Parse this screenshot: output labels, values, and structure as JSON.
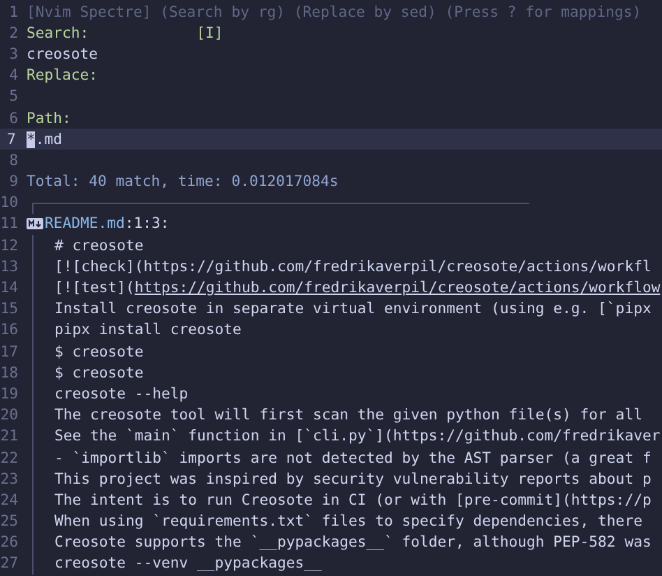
{
  "lines": [
    {
      "number": "1",
      "kind": "header",
      "current": false,
      "text": "[Nvim Spectre] (Search by rg)  (Replace by sed) (Press ? for mappings)"
    },
    {
      "number": "2",
      "kind": "label",
      "current": false,
      "text": "Search:",
      "flag": "[I]"
    },
    {
      "number": "3",
      "kind": "value",
      "current": false,
      "text": "creosote"
    },
    {
      "number": "4",
      "kind": "label",
      "current": false,
      "text": "Replace:"
    },
    {
      "number": "5",
      "kind": "blank",
      "current": false
    },
    {
      "number": "6",
      "kind": "label",
      "current": false,
      "text": "Path:"
    },
    {
      "number": "7",
      "kind": "input",
      "current": true,
      "cursor": "*",
      "text": ".md"
    },
    {
      "number": "8",
      "kind": "blank",
      "current": false
    },
    {
      "number": "9",
      "kind": "total",
      "current": false,
      "text": "Total: 40 match, time: 0.012017084s"
    },
    {
      "number": "10",
      "kind": "separator",
      "current": false
    },
    {
      "number": "11",
      "kind": "file",
      "current": false,
      "file": "README.md",
      "location": ":1:3:"
    },
    {
      "number": "12",
      "kind": "match",
      "current": false,
      "text": "# creosote"
    },
    {
      "number": "13",
      "kind": "match",
      "current": false,
      "text": "[![check](https://github.com/fredrikaverpil/creosote/actions/workfl"
    },
    {
      "number": "14",
      "kind": "match",
      "current": false,
      "text": "[![test](",
      "link": "https://github.com/fredrikaverpil/creosote/actions/workflow"
    },
    {
      "number": "15",
      "kind": "match",
      "current": false,
      "text": "Install creosote in separate virtual environment (using e.g. [`pipx"
    },
    {
      "number": "16",
      "kind": "match",
      "current": false,
      "text": "pipx install creosote"
    },
    {
      "number": "17",
      "kind": "match",
      "current": false,
      "text": "$ creosote"
    },
    {
      "number": "18",
      "kind": "match",
      "current": false,
      "text": "$ creosote"
    },
    {
      "number": "19",
      "kind": "match",
      "current": false,
      "text": "creosote --help"
    },
    {
      "number": "20",
      "kind": "match",
      "current": false,
      "text": "The creosote tool will first scan the given python file(s) for all"
    },
    {
      "number": "21",
      "kind": "match",
      "current": false,
      "text": "See the `main` function in [`cli.py`](https://github.com/fredrikaver"
    },
    {
      "number": "22",
      "kind": "match",
      "current": false,
      "text": "- `importlib` imports are not detected by the AST parser (a great f"
    },
    {
      "number": "23",
      "kind": "match",
      "current": false,
      "text": "This project was inspired by security vulnerability reports about p"
    },
    {
      "number": "24",
      "kind": "match",
      "current": false,
      "text": "The intent is to run Creosote in CI (or with [pre-commit](https://p"
    },
    {
      "number": "25",
      "kind": "match",
      "current": false,
      "text": "When using `requirements.txt` files to specify dependencies, there"
    },
    {
      "number": "26",
      "kind": "match",
      "current": false,
      "text": "Creosote supports the `__pypackages__` folder, although PEP-582 was"
    },
    {
      "number": "27",
      "kind": "match",
      "current": false,
      "text": "creosote --venv __pypackages__"
    }
  ]
}
